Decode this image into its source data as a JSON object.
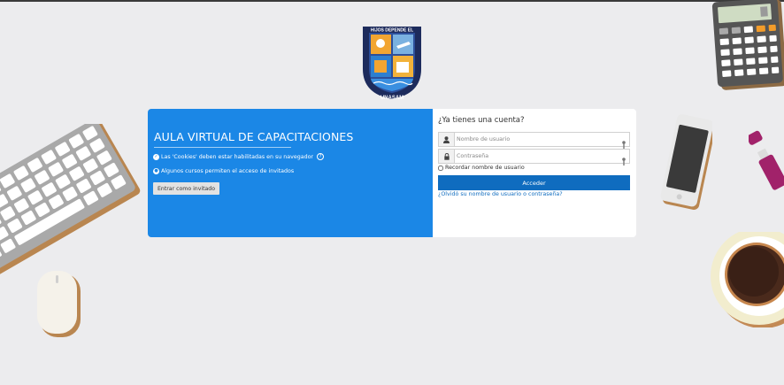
{
  "crest": {
    "top_text": "HIJOS DEPENDE EL",
    "bottom_text": "UNASAM"
  },
  "login_left": {
    "title": "AULA VIRTUAL DE CAPACITACIONES",
    "cookies_notice": "Las 'Cookies' deben estar habilitadas en su navegador",
    "guest_notice": "Algunos cursos permiten el acceso de invitados",
    "guest_button": "Entrar como invitado"
  },
  "login_right": {
    "heading": "¿Ya tienes una cuenta?",
    "username_placeholder": "Nombre de usuario",
    "password_placeholder": "Contraseña",
    "remember_label": "Recordar nombre de usuario",
    "login_button": "Acceder",
    "forgot_link": "¿Olvidó su nombre de usuario o contraseña?"
  },
  "colors": {
    "brand_blue": "#1b87e6",
    "button_blue": "#0f6cbf",
    "background": "#ececee"
  },
  "icons": [
    "user-icon",
    "lock-icon",
    "key-icon",
    "help-icon",
    "check-circle-icon",
    "person-circle-icon"
  ]
}
